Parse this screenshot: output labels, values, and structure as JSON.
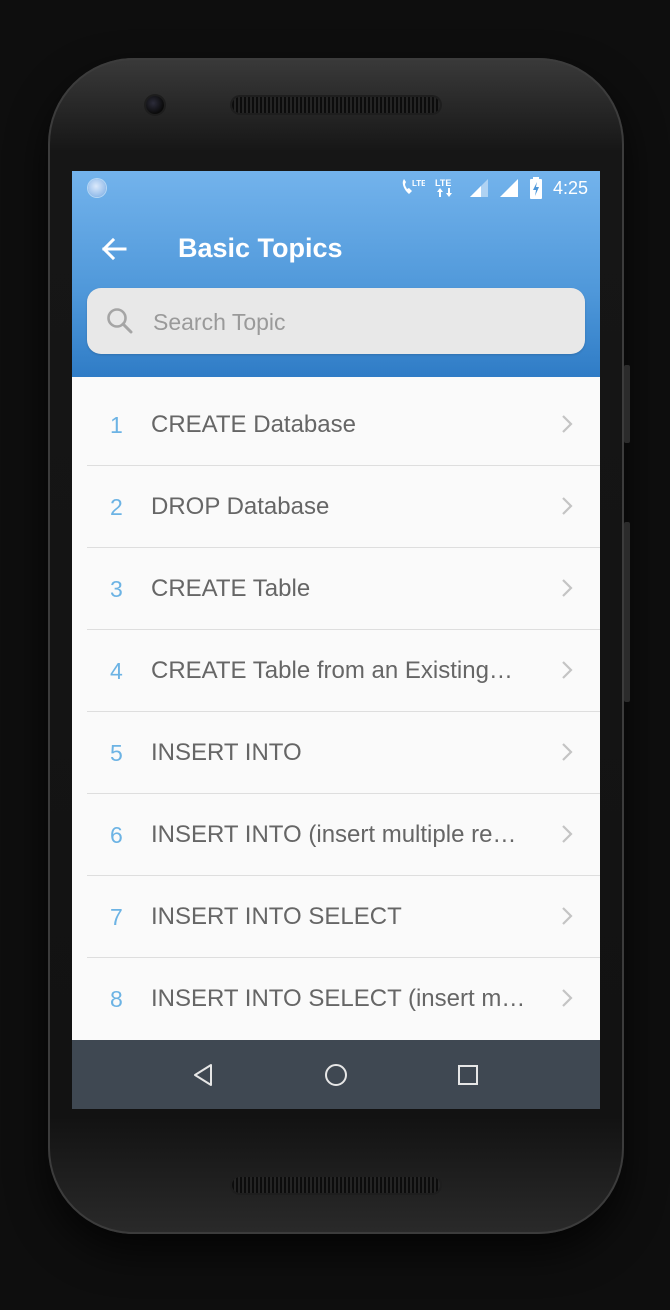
{
  "status_bar": {
    "time": "4:25",
    "icons": [
      "notification-dot-icon",
      "wifi-calling-icon",
      "lte-data-icon",
      "signal-icon",
      "signal-icon",
      "battery-charging-icon"
    ]
  },
  "app_bar": {
    "title": "Basic Topics",
    "back_icon": "arrow-left-icon"
  },
  "search": {
    "placeholder": "Search Topic",
    "value": "",
    "icon": "search-icon"
  },
  "topics": [
    {
      "number": "1",
      "label": "CREATE Database"
    },
    {
      "number": "2",
      "label": "DROP Database"
    },
    {
      "number": "3",
      "label": "CREATE Table"
    },
    {
      "number": "4",
      "label": "CREATE Table from an Existing…"
    },
    {
      "number": "5",
      "label": "INSERT INTO"
    },
    {
      "number": "6",
      "label": "INSERT INTO (insert multiple re…"
    },
    {
      "number": "7",
      "label": "INSERT INTO SELECT"
    },
    {
      "number": "8",
      "label": "INSERT INTO SELECT (insert m…"
    }
  ],
  "nav_bar": {
    "buttons": [
      "back-triangle-icon",
      "home-circle-icon",
      "recents-square-icon"
    ]
  },
  "colors": {
    "header_top": "#73b3ec",
    "header_bottom": "#2f7cc6",
    "number_accent": "#6cb3e4",
    "nav_bar": "#3f4852"
  }
}
